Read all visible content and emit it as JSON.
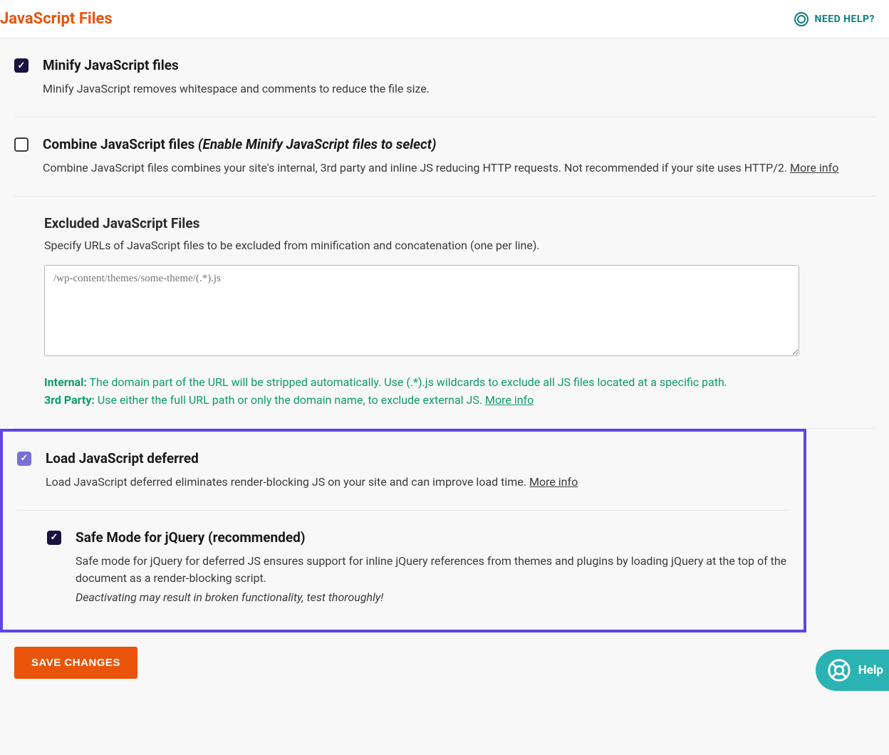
{
  "header": {
    "title": "JavaScript Files",
    "help_label": "NEED HELP?"
  },
  "options": {
    "minify": {
      "title": "Minify JavaScript files",
      "desc": "Minify JavaScript removes whitespace and comments to reduce the file size.",
      "checked": true
    },
    "combine": {
      "title": "Combine JavaScript files ",
      "note": "(Enable Minify JavaScript files to select)",
      "desc": "Combine JavaScript files combines your site's internal, 3rd party and inline JS reducing HTTP requests. Not recommended if your site uses HTTP/2. ",
      "more_info": "More info",
      "checked": false
    },
    "excluded": {
      "title": "Excluded JavaScript Files",
      "desc": "Specify URLs of JavaScript files to be excluded from minification and concatenation (one per line).",
      "placeholder": "/wp-content/themes/some-theme/(.*).js",
      "hints": {
        "internal_label": "Internal:",
        "internal_text": " The domain part of the URL will be stripped automatically. Use (.*).js wildcards to exclude all JS files located at a specific path.",
        "third_party_label": "3rd Party:",
        "third_party_text": " Use either the full URL path or only the domain name, to exclude external JS. ",
        "more_info": "More info"
      }
    },
    "defer": {
      "title": "Load JavaScript deferred",
      "desc": "Load JavaScript deferred eliminates render-blocking JS on your site and can improve load time. ",
      "more_info": "More info",
      "checked": true
    },
    "safe_mode": {
      "title": "Safe Mode for jQuery (recommended)",
      "desc": "Safe mode for jQuery for deferred JS ensures support for inline jQuery references from themes and plugins by loading jQuery at the top of the document as a render-blocking script.",
      "warning": "Deactivating may result in broken functionality, test thoroughly!",
      "checked": true
    }
  },
  "save_button": "SAVE CHANGES",
  "help_widget_label": "Help"
}
